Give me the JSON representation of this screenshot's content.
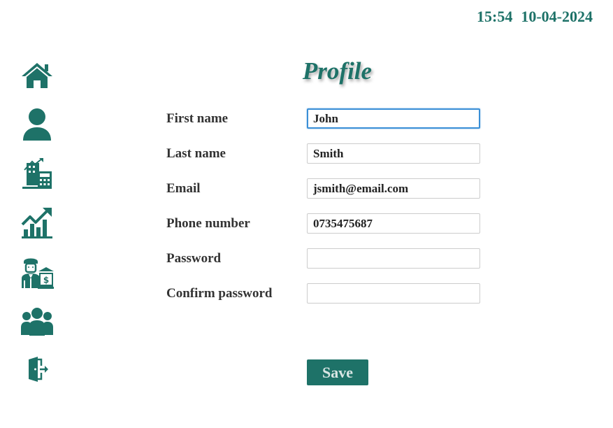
{
  "header": {
    "time": "15:54",
    "date": "10-04-2024"
  },
  "colors": {
    "accent": "#1e7268",
    "focus_border": "#3a8fd6"
  },
  "sidebar": {
    "items": [
      {
        "icon": "home-icon"
      },
      {
        "icon": "user-icon"
      },
      {
        "icon": "finance-calculator-icon"
      },
      {
        "icon": "growth-chart-icon"
      },
      {
        "icon": "banker-icon"
      },
      {
        "icon": "group-icon"
      },
      {
        "icon": "logout-icon"
      }
    ]
  },
  "page": {
    "title": "Profile"
  },
  "form": {
    "first_name": {
      "label": "First name",
      "value": "John"
    },
    "last_name": {
      "label": "Last name",
      "value": "Smith"
    },
    "email": {
      "label": "Email",
      "value": "jsmith@email.com"
    },
    "phone": {
      "label": "Phone number",
      "value": "0735475687"
    },
    "password": {
      "label": "Password",
      "value": ""
    },
    "confirm_password": {
      "label": "Confirm password",
      "value": ""
    },
    "save_label": "Save"
  }
}
